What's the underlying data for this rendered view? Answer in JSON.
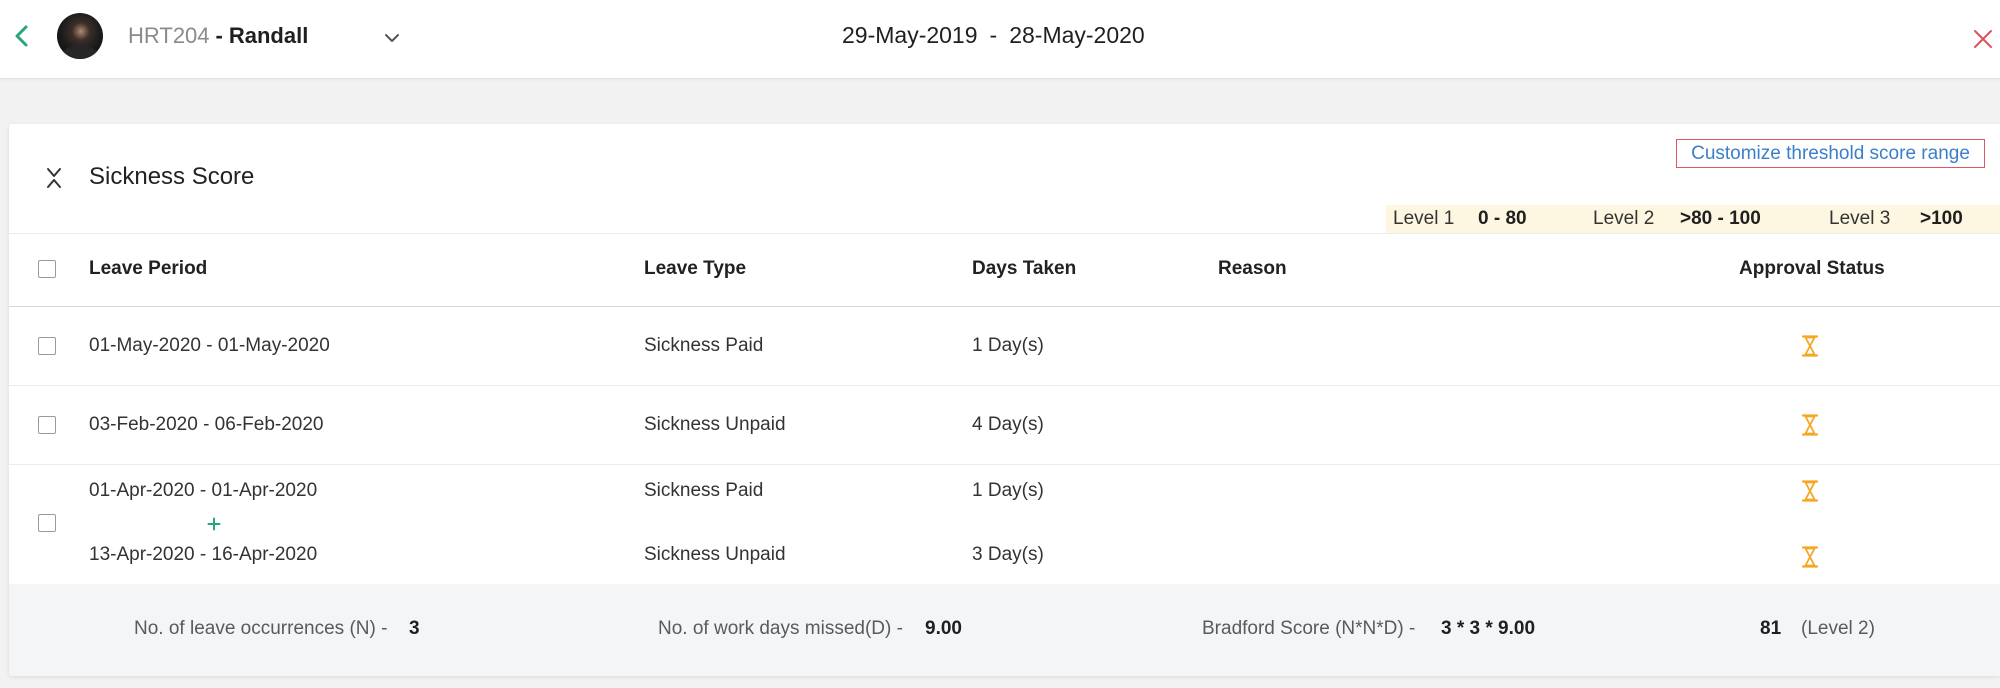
{
  "header": {
    "employee_id": "HRT204",
    "name_separator": "-",
    "employee_name": "Randall",
    "date_from": "29-May-2019",
    "date_separator": "-",
    "date_to": "28-May-2020",
    "icons": {
      "back": "chevron-left-icon",
      "employee_switch": "chevron-down-icon",
      "close": "close-icon"
    }
  },
  "section": {
    "title": "Sickness Score",
    "collapse_icon": "collapse-icon",
    "customize_link": "Customize threshold score range",
    "levels": [
      {
        "label": "Level 1",
        "range": "0 - 80"
      },
      {
        "label": "Level 2",
        "range": ">80 - 100"
      },
      {
        "label": "Level 3",
        "range": ">100"
      }
    ]
  },
  "table": {
    "select_all_checked": false,
    "columns": [
      "Leave Period",
      "Leave Type",
      "Days Taken",
      "Reason",
      "Approval Status"
    ],
    "rows": [
      {
        "checked": false,
        "entries": [
          {
            "period": "01-May-2020 - 01-May-2020",
            "type": "Sickness Paid",
            "days": "1 Day(s)",
            "status_icon": "hourglass-icon"
          }
        ]
      },
      {
        "checked": false,
        "entries": [
          {
            "period": "03-Feb-2020 - 06-Feb-2020",
            "type": "Sickness Unpaid",
            "days": "4 Day(s)",
            "status_icon": "hourglass-icon"
          }
        ]
      },
      {
        "checked": false,
        "joined_icon": "plus-icon",
        "entries": [
          {
            "period": "01-Apr-2020 - 01-Apr-2020",
            "type": "Sickness Paid",
            "days": "1 Day(s)",
            "status_icon": "hourglass-icon"
          },
          {
            "period": "13-Apr-2020 - 16-Apr-2020",
            "type": "Sickness Unpaid",
            "days": "3 Day(s)",
            "status_icon": "hourglass-icon"
          }
        ]
      }
    ]
  },
  "summary": {
    "occurrences_label": "No. of leave occurrences (N) -",
    "occurrences_value": "3",
    "days_missed_label": "No. of work days missed(D) -",
    "days_missed_value": "9.00",
    "bradford_label": "Bradford Score (N*N*D) -",
    "bradford_formula": "3 * 3 * 9.00",
    "bradford_score": "81",
    "bradford_level": "(Level 2)"
  },
  "colors": {
    "accent_green": "#27a57e",
    "close_red": "#e0505b",
    "link_blue": "#3a7fc9",
    "link_border": "#e2575f",
    "pending_orange": "#f5a623",
    "level_bar_bg": "#fdf7e1",
    "summary_bg": "#f4f5f7",
    "page_bg": "#f2f2f2"
  }
}
